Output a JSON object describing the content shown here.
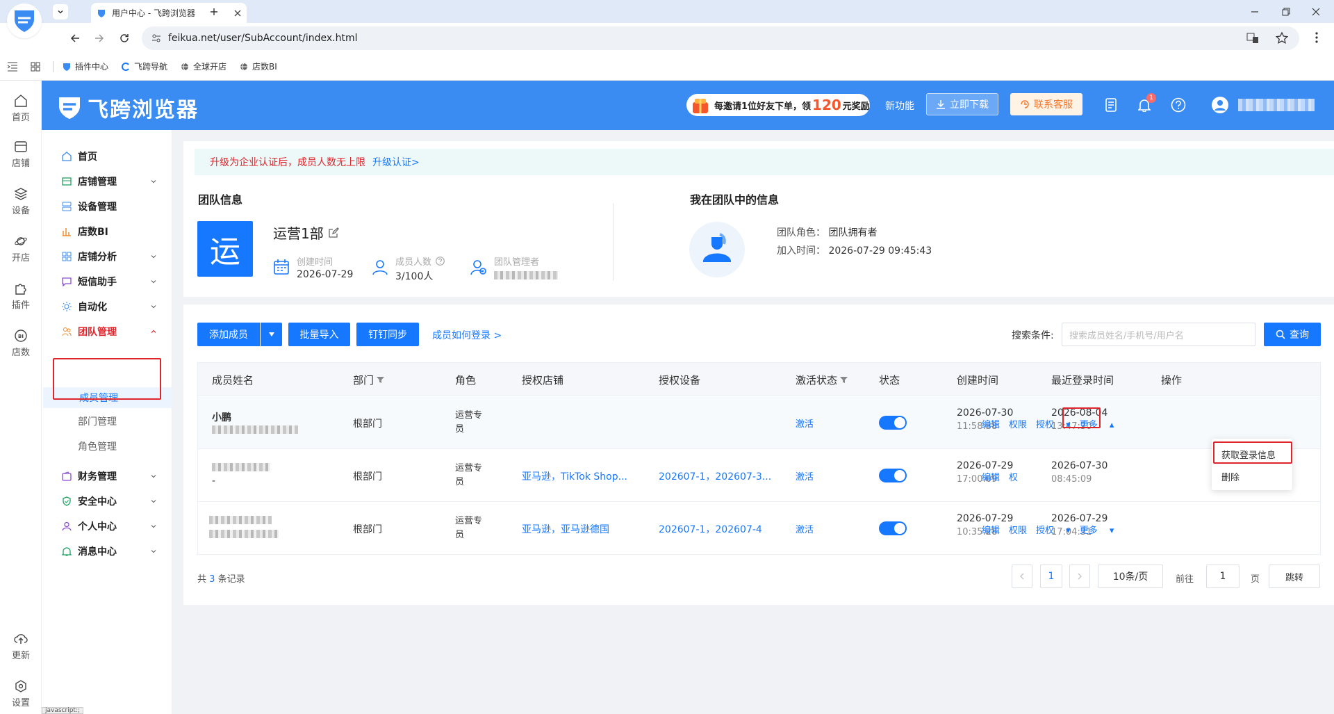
{
  "browser": {
    "tab_title": "用户中心 - 飞跨浏览器",
    "url": "feikua.net/user/SubAccount/index.html",
    "bookmarks": [
      "插件中心",
      "飞跨导航",
      "全球开店",
      "店数BI"
    ],
    "status_tip": "javascript:;"
  },
  "rail": [
    {
      "label": "首页",
      "icon": "home-icon"
    },
    {
      "label": "店铺",
      "icon": "store-icon"
    },
    {
      "label": "设备",
      "icon": "layers-icon"
    },
    {
      "label": "开店",
      "icon": "planet-icon"
    },
    {
      "label": "插件",
      "icon": "puzzle-icon"
    },
    {
      "label": "店数",
      "icon": "bi-icon"
    },
    {
      "label": "更新",
      "icon": "cloud-upload-icon"
    },
    {
      "label": "设置",
      "icon": "settings-icon"
    }
  ],
  "header": {
    "brand": "飞跨浏览器",
    "promo_prefix": "每邀请1位好友下单，领",
    "promo_amount": "120",
    "promo_suffix": "元奖励",
    "new_feature": "新功能",
    "download": "立即下载",
    "support": "联系客服",
    "notification_count": "1",
    "colors": {
      "primary": "#3a8bf2",
      "accent": "#1677ff",
      "danger": "#e0242b"
    }
  },
  "sidebar": {
    "items": [
      {
        "label": "首页",
        "icon": "home-icon"
      },
      {
        "label": "店铺管理",
        "icon": "store-icon"
      },
      {
        "label": "设备管理",
        "icon": "device-icon"
      },
      {
        "label": "店数BI",
        "icon": "bar-chart-icon"
      },
      {
        "label": "店铺分析",
        "icon": "grid-icon"
      },
      {
        "label": "短信助手",
        "icon": "message-icon"
      },
      {
        "label": "自动化",
        "icon": "sun-icon"
      },
      {
        "label": "团队管理",
        "icon": "team-icon"
      },
      {
        "label": "财务管理",
        "icon": "wallet-icon"
      },
      {
        "label": "安全中心",
        "icon": "shield-icon"
      },
      {
        "label": "个人中心",
        "icon": "user-icon"
      },
      {
        "label": "消息中心",
        "icon": "bell-icon"
      }
    ],
    "team_subitems": [
      "成员管理",
      "部门管理",
      "角色管理"
    ]
  },
  "notice": {
    "text": "升级为企业认证后，成员人数无上限",
    "link": "升级认证>"
  },
  "team_info": {
    "title": "团队信息",
    "logo_char": "运",
    "name": "运营1部",
    "created_label": "创建时间",
    "created_value": "2026-07-29",
    "members_label": "成员人数",
    "members_value": "3/100人",
    "admin_label": "团队管理者"
  },
  "my_info": {
    "title": "我在团队中的信息",
    "role_label": "团队角色：",
    "role_value": "团队拥有者",
    "join_label": "加入时间：",
    "join_value": "2026-07-29 09:45:43"
  },
  "toolbar": {
    "add_member": "添加成员",
    "batch_import": "批量导入",
    "dingtalk_sync": "钉钉同步",
    "how_login": "成员如何登录 >",
    "search_label": "搜索条件:",
    "search_placeholder": "搜索成员姓名/手机号/用户名",
    "query": "查询"
  },
  "table": {
    "columns": [
      "成员姓名",
      "部门",
      "角色",
      "授权店铺",
      "授权设备",
      "激活状态",
      "状态",
      "创建时间",
      "最近登录时间",
      "操作"
    ],
    "rows": [
      {
        "name": "小鹏",
        "dept": "根部门",
        "role": "运营专员",
        "stores": "",
        "devices": "",
        "activation": "激活",
        "enabled": true,
        "created_date": "2026-07-30",
        "created_time": "11:58:38",
        "login_date": "2026-08-04",
        "login_time": "13:47:30"
      },
      {
        "name": "",
        "name_sub": "-",
        "dept": "根部门",
        "role": "运营专员",
        "stores": "亚马逊，TikTok Shop...",
        "devices": "202607-1，202607-3...",
        "activation": "激活",
        "enabled": true,
        "created_date": "2026-07-29",
        "created_time": "17:00:09",
        "login_date": "2026-07-30",
        "login_time": "08:45:09"
      },
      {
        "name": "",
        "dept": "根部门",
        "role": "运营专员",
        "stores": "亚马逊，亚马逊德国",
        "devices": "202607-1，202607-4",
        "activation": "激活",
        "enabled": true,
        "created_date": "2026-07-29",
        "created_time": "10:35:28",
        "login_date": "2026-07-29",
        "login_time": "17:04:31"
      }
    ],
    "ops": {
      "edit": "编辑",
      "perm": "权限",
      "auth": "授权",
      "more": "更多",
      "perm_cut": "权"
    },
    "dropdown": [
      "获取登录信息",
      "删除"
    ]
  },
  "pagination": {
    "total_prefix": "共",
    "total": "3",
    "total_suffix": "条记录",
    "current_page": "1",
    "page_size": "10条/页",
    "goto_label": "前往",
    "goto_value": "1",
    "page_unit": "页",
    "jump": "跳转"
  }
}
